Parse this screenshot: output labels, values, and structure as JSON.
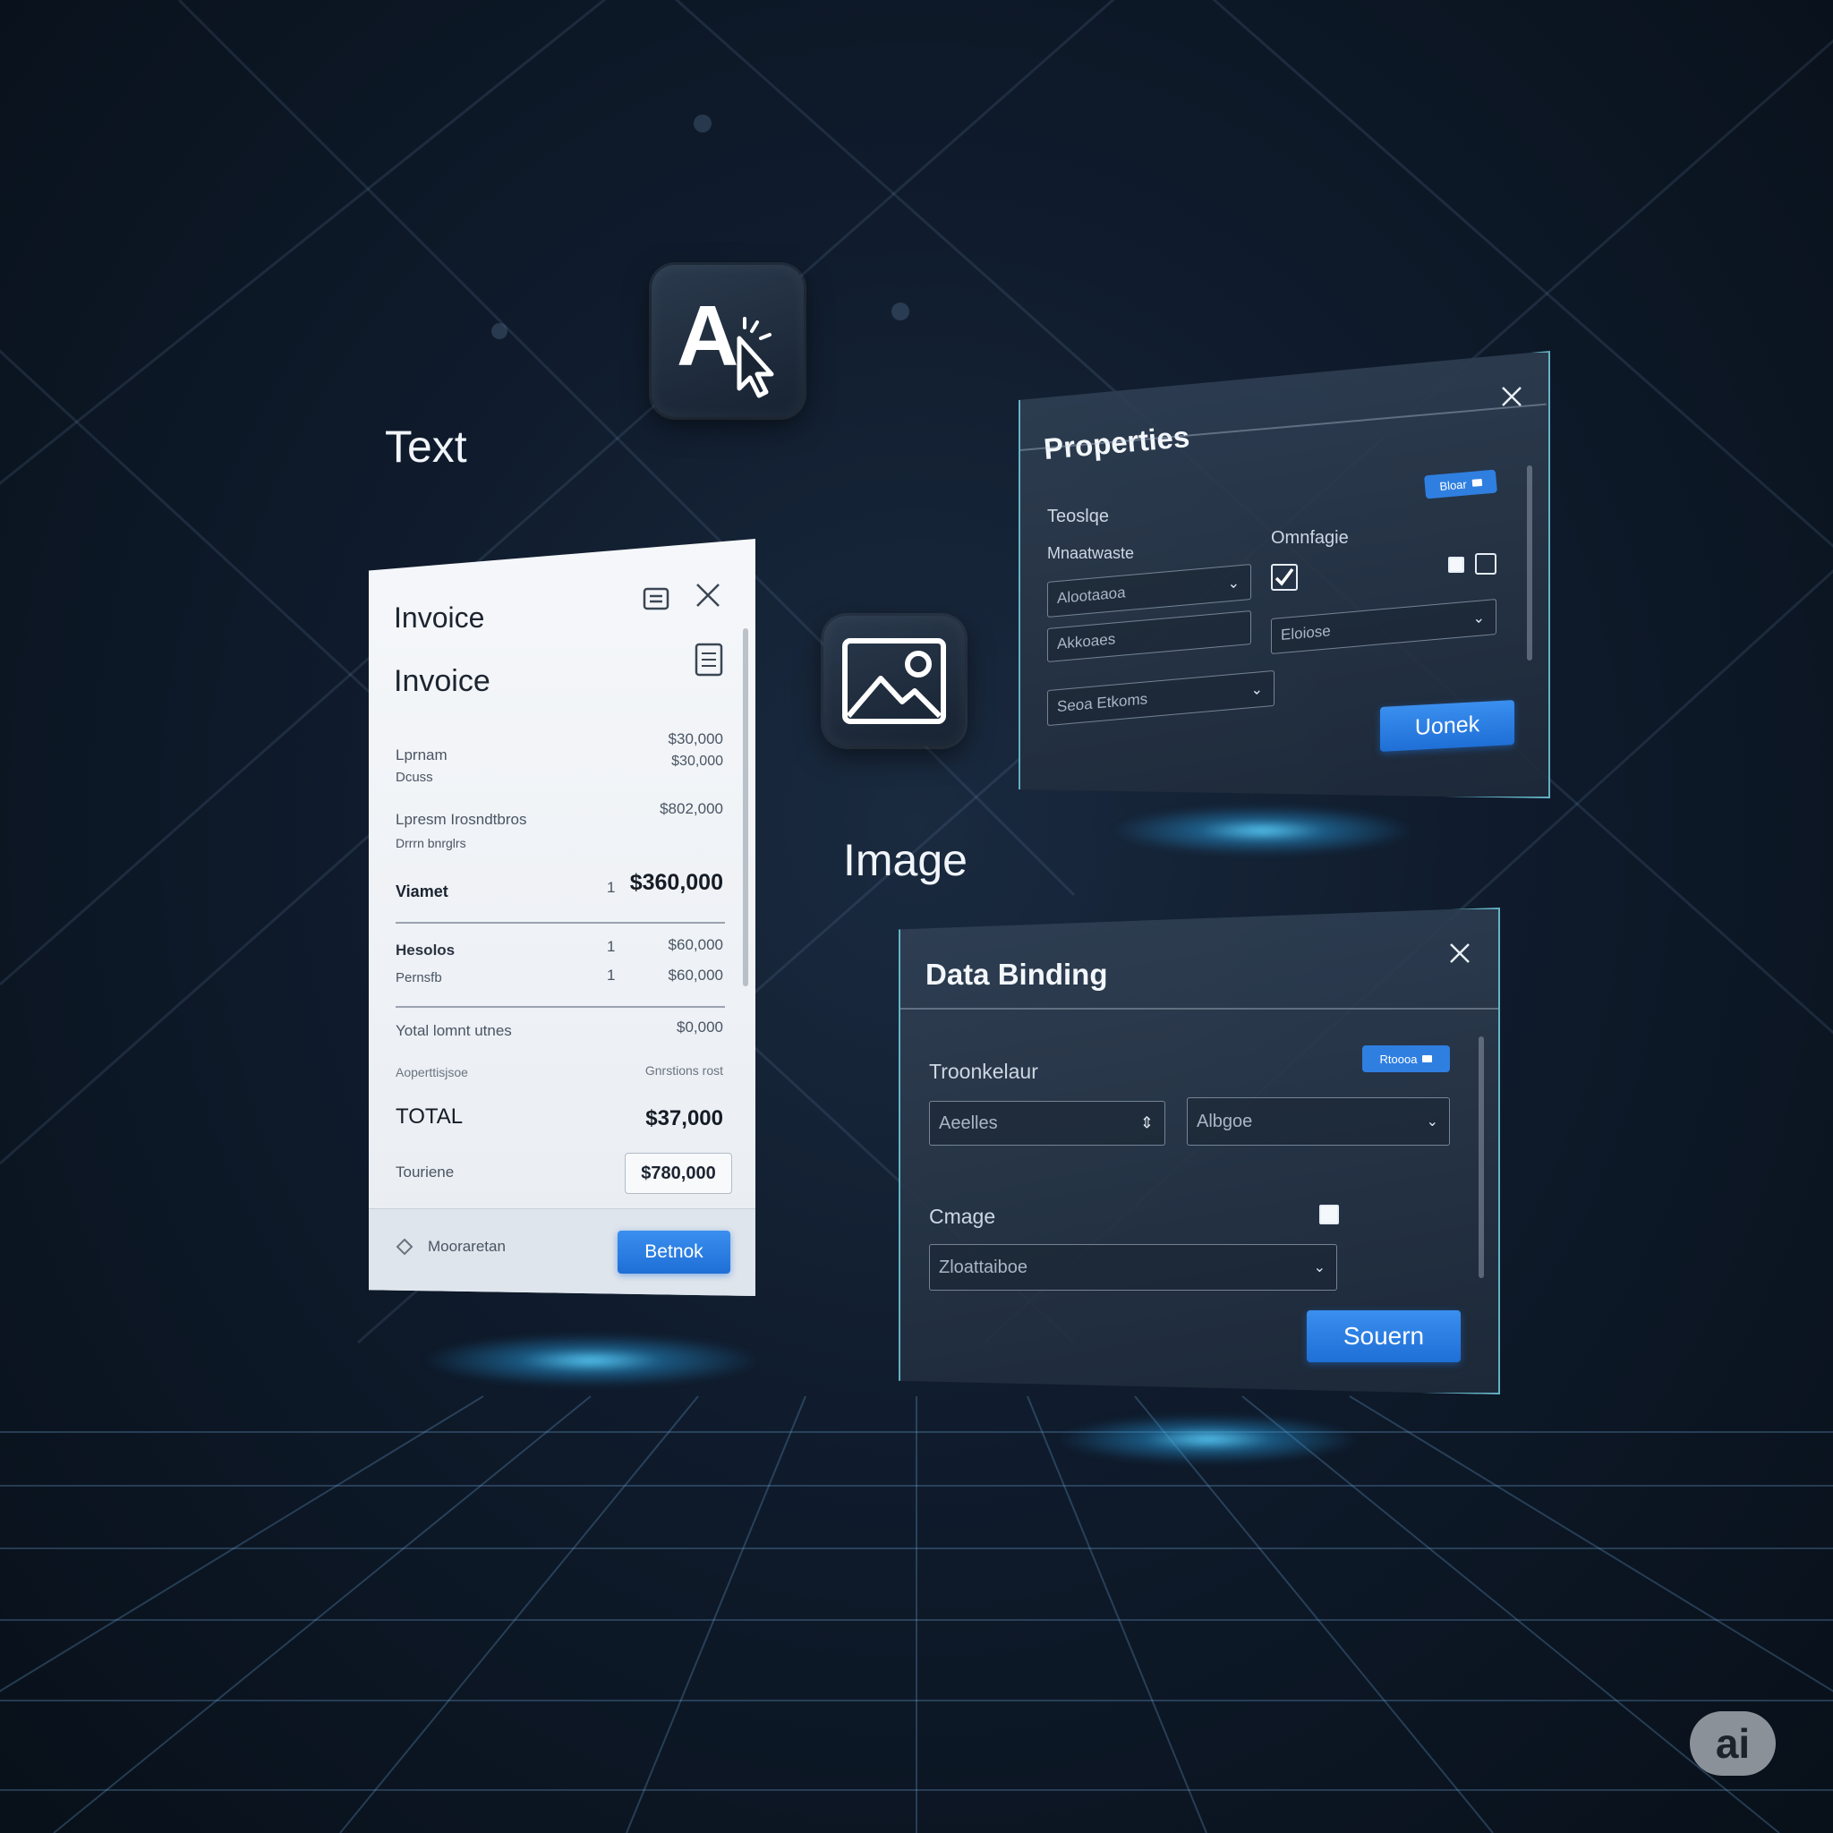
{
  "labels": {
    "text": "Text",
    "image": "Image"
  },
  "invoice": {
    "title_small": "Invoice",
    "title_large": "Invoice",
    "rows": [
      {
        "label": "Lprnam",
        "sub": "Dcuss",
        "value1": "$30,000",
        "value2": "$30,000"
      },
      {
        "label": "Lpresm Irosndtbros",
        "sub": "Drrrn bnrglrs",
        "value1": "$802,000"
      }
    ],
    "bold_row": {
      "label": "Viamet",
      "qty": "1",
      "value": "$360,000"
    },
    "items": [
      {
        "label": "Hesolos",
        "qty": "1",
        "value": "$60,000"
      },
      {
        "label": "Pernsfb",
        "qty": "1",
        "value": "$60,000"
      }
    ],
    "total_line": {
      "label": "Yotal lomnt utnes",
      "value": "$0,000"
    },
    "sub_line": {
      "label": "Aoperttisjsoe",
      "value": "Gnrstions rost"
    },
    "total": {
      "label": "TOTAL",
      "value": "$37,000"
    },
    "total_field": {
      "label": "Touriene",
      "value": "$780,000"
    },
    "footer": {
      "text": "Mooraretan",
      "button": "Betnok"
    }
  },
  "properties": {
    "title": "Properties",
    "pill": "Bloar",
    "section": "Teoslqe",
    "left_label": "Mnaatwaste",
    "right_label": "Omnfagie",
    "field1": "Alootaaoa",
    "field2": "Akkoaes",
    "field3": "Seoa Etkoms",
    "field4": "Eloiose",
    "button": "Uonek"
  },
  "data_binding": {
    "title": "Data Binding",
    "pill": "Rtoooa",
    "label1": "Troonkelaur",
    "field1": "Aeelles",
    "field2": "Albgoe",
    "label2": "Cmage",
    "field3": "Zloattaiboe",
    "button": "Souern"
  },
  "badge": "ai",
  "colors": {
    "accent": "#2f7fe0",
    "glow": "#5ad2ff",
    "bg": "#0f1b2c"
  }
}
